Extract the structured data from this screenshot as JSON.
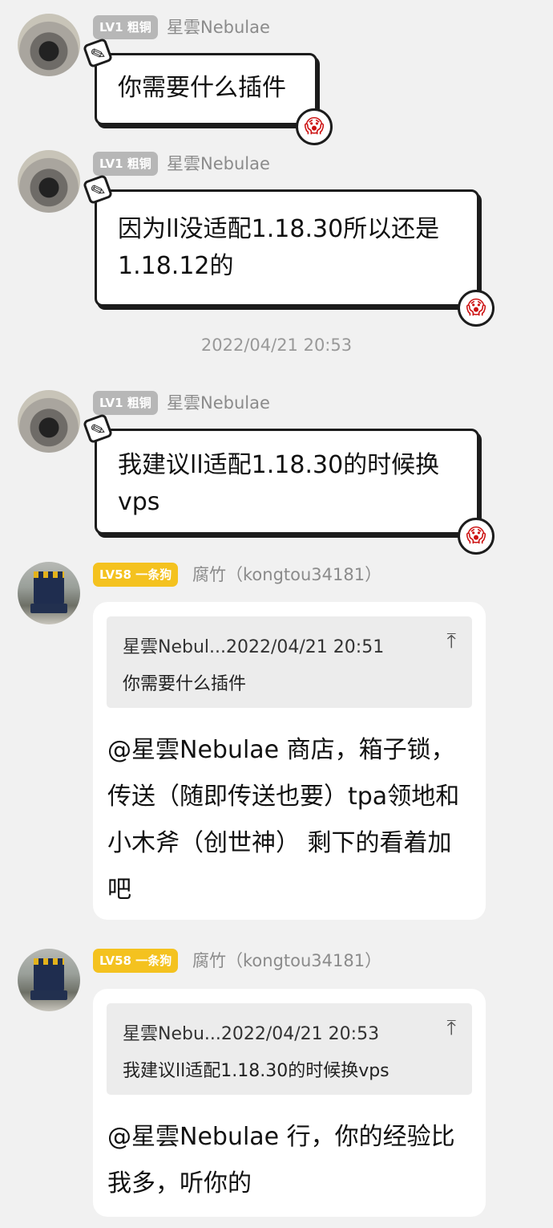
{
  "messages": [
    {
      "badge": "LV1 粗铜",
      "username": "星雲Nebulae",
      "text": "你需要什么插件"
    },
    {
      "badge": "LV1 粗铜",
      "username": "星雲Nebulae",
      "text": "因为ll没适配1.18.30所以还是1.18.12的"
    },
    {
      "badge": "LV1 粗铜",
      "username": "星雲Nebulae",
      "text": "我建议ll适配1.18.30的时候换vps"
    },
    {
      "badge": "LV58 一条狗",
      "username": "腐竹（kongtou34181）",
      "quote_header": "星雲Nebul...2022/04/21 20:51",
      "quote_text": "你需要什么插件",
      "text": "@星雲Nebulae 商店，箱子锁，传送（随即传送也要）tpa领地和小木斧（创世神） 剩下的看着加吧"
    },
    {
      "badge": "LV58 一条狗",
      "username": "腐竹（kongtou34181）",
      "quote_header": "星雲Nebu...2022/04/21 20:53",
      "quote_text": "我建议ll适配1.18.30的时候换vps",
      "text": "@星雲Nebulae 行，你的经验比我多，听你的"
    }
  ],
  "timestamp": "2022/04/21 20:53",
  "icons": {
    "clip": "paperclip-icon",
    "face": "screaming-face-icon",
    "jump": "jump-to-top-icon"
  },
  "colors": {
    "badge_gray": "#b7b7b7",
    "badge_gold": "#f4c21f",
    "background": "#f1f1f1"
  }
}
